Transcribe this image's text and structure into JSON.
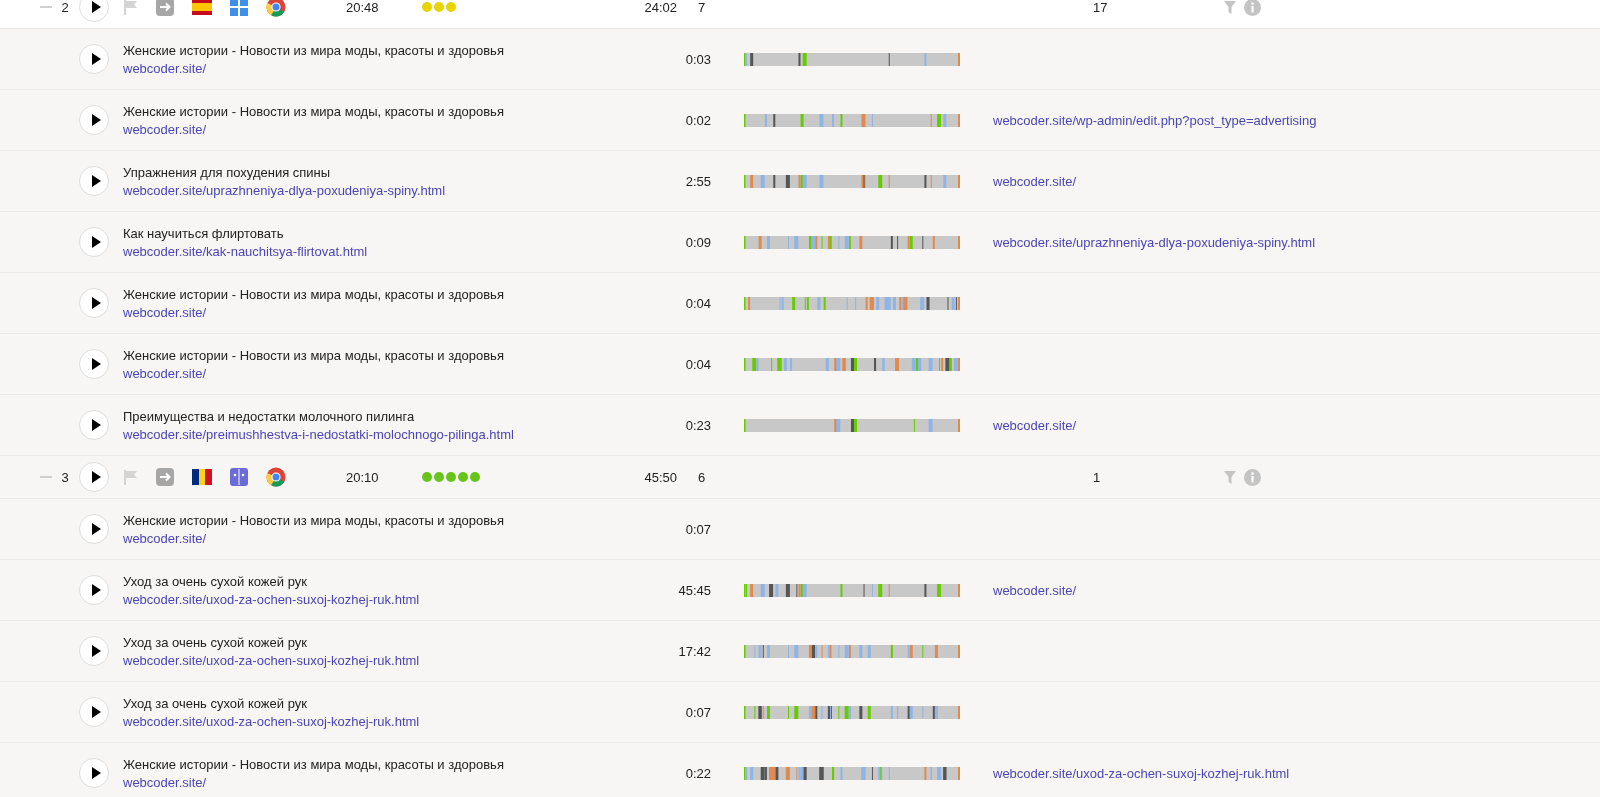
{
  "groups": [
    {
      "number": "2",
      "expanded": true,
      "icons": [
        {
          "kind": "entry"
        },
        {
          "kind": "spain"
        },
        {
          "kind": "windows"
        },
        {
          "kind": "chrome"
        }
      ],
      "time": "20:48",
      "stars": 3,
      "color": "#e8d400",
      "duration": "24:02",
      "pages": "7",
      "count": "17",
      "visits": [
        {
          "title": "Женские истории - Новости из мира моды, красоты и здоровья",
          "url": "webcoder.site/",
          "duration": "0:03",
          "timeline": true
        },
        {
          "title": "Женские истории - Новости из мира моды, красоты и здоровья",
          "url": "webcoder.site/",
          "duration": "0:02",
          "timeline": true,
          "referrer": "webcoder.site/wp-admin/edit.php?post_type=advertising"
        },
        {
          "title": "Упражнения для похудения спины",
          "url": "webcoder.site/uprazhneniya-dlya-poxudeniya-spiny.html",
          "duration": "2:55",
          "timeline": true,
          "referrer": "webcoder.site/"
        },
        {
          "title": "Как научиться флиртовать",
          "url": "webcoder.site/kak-nauchitsya-flirtovat.html",
          "duration": "0:09",
          "timeline": true,
          "referrer": "webcoder.site/uprazhneniya-dlya-poxudeniya-spiny.html"
        },
        {
          "title": "Женские истории - Новости из мира моды, красоты и здоровья",
          "url": "webcoder.site/",
          "duration": "0:04",
          "timeline": true
        },
        {
          "title": "Женские истории - Новости из мира моды, красоты и здоровья",
          "url": "webcoder.site/",
          "duration": "0:04",
          "timeline": true
        },
        {
          "title": "Преимущества и недостатки молочного пилинга",
          "url": "webcoder.site/preimushhestva-i-nedostatki-molochnogo-pilinga.html",
          "duration": "0:23",
          "timeline": true,
          "referrer": "webcoder.site/"
        }
      ]
    },
    {
      "number": "3",
      "expanded": true,
      "icons": [
        {
          "kind": "entry"
        },
        {
          "kind": "romania"
        },
        {
          "kind": "finder"
        },
        {
          "kind": "chrome"
        }
      ],
      "time": "20:10",
      "stars": 5,
      "color": "#66c41a",
      "duration": "45:50",
      "pages": "6",
      "count": "1",
      "visits": [
        {
          "title": "Женские истории - Новости из мира моды, красоты и здоровья",
          "url": "webcoder.site/",
          "duration": "0:07",
          "timeline": false
        },
        {
          "title": "Уход за очень сухой кожей рук",
          "url": "webcoder.site/uxod-za-ochen-suxoj-kozhej-ruk.html",
          "duration": "45:45",
          "timeline": true,
          "referrer": "webcoder.site/"
        },
        {
          "title": "Уход за очень сухой кожей рук",
          "url": "webcoder.site/uxod-za-ochen-suxoj-kozhej-ruk.html",
          "duration": "17:42",
          "timeline": true
        },
        {
          "title": "Уход за очень сухой кожей рук",
          "url": "webcoder.site/uxod-za-ochen-suxoj-kozhej-ruk.html",
          "duration": "0:07",
          "timeline": true
        },
        {
          "title": "Женские истории - Новости из мира моды, красоты и здоровья",
          "url": "webcoder.site/",
          "duration": "0:22",
          "timeline": true,
          "referrer": "webcoder.site/uxod-za-ochen-suxoj-kozhej-ruk.html"
        }
      ]
    }
  ]
}
